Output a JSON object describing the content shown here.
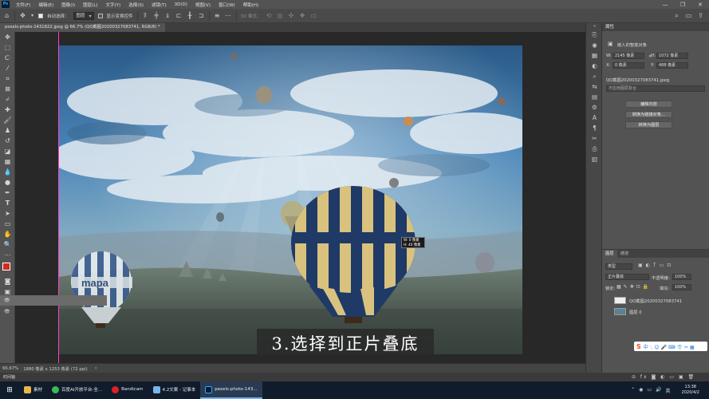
{
  "app": {
    "logo": "Ps"
  },
  "menu": {
    "items": [
      "文件(F)",
      "编辑(E)",
      "图像(I)",
      "图层(L)",
      "文字(Y)",
      "选择(S)",
      "滤镜(T)",
      "3D(D)",
      "视图(V)",
      "窗口(W)",
      "帮助(H)"
    ]
  },
  "window_controls": {
    "minimize": "—",
    "maximize": "❐",
    "close": "✕"
  },
  "options": {
    "auto_select_label": "自动选择：",
    "auto_select_value": "图层",
    "show_transform_label": "显示变换控件",
    "mode_label": "3D 模式："
  },
  "document_tab": {
    "label": "pexels-photo-1431822.jpeg @ 66.7% (QQ截图20200327083741, RGB/8) *"
  },
  "canvas": {
    "tooltip_w": "W: 0 像素",
    "tooltip_h": "H: 40 像素",
    "caption": "3.选择到正片叠底",
    "balloon_text": "mapa"
  },
  "status": {
    "zoom": "66.67%",
    "doc": "1880 像素 x 1253 像素 (72 ppi)"
  },
  "bottom_label": "时间轴",
  "properties": {
    "tab": "属性",
    "title": "嵌入的智能对象",
    "w_label": "W:",
    "w_value": "2145 像素",
    "h_label": "H:",
    "h_value": "1072 像素",
    "x_label": "X:",
    "x_value": "0 像素",
    "y_label": "Y:",
    "y_value": "488 像素",
    "filename": "QQ截图20200327083741.jpeg",
    "no_comp": "不应用图层复合",
    "btn_edit": "编辑内容",
    "btn_convert_linked": "转换为链接对象…",
    "btn_convert_layer": "转换为图层"
  },
  "layers": {
    "tab_layers": "图层",
    "tab_channels": "通道",
    "filter_label": "类型",
    "blend_mode": "正片叠底",
    "opacity_label": "不透明度:",
    "opacity_value": "100%",
    "lock_label": "锁定:",
    "fill_label": "填充:",
    "fill_value": "100%",
    "rows": [
      {
        "name": "QQ截图20200327083741"
      },
      {
        "name": "图层 0"
      }
    ],
    "footer_icons": "⊝ fx ◙ ◐ ▭ ▣ 🗑"
  },
  "ime": {
    "label": "S",
    "icons": "中 ·, ☺ 🎤 ⌨ 👕 ✂ ▦"
  },
  "taskbar": {
    "items": [
      "素材",
      "百度AI开放平台-全...",
      "Bandicam",
      "4.2文案 - 记事本",
      "pexels-photo-143..."
    ],
    "tray_icons": [
      "⌃",
      "◉",
      "▭",
      "🔊",
      "英"
    ],
    "time": "13:38",
    "date": "2020/4/2"
  },
  "colors": {
    "ps_blue": "#31a8ff",
    "fg_color": "#d62a1c",
    "bg_color": "#ffffff",
    "guide": "#ff3ec9"
  }
}
